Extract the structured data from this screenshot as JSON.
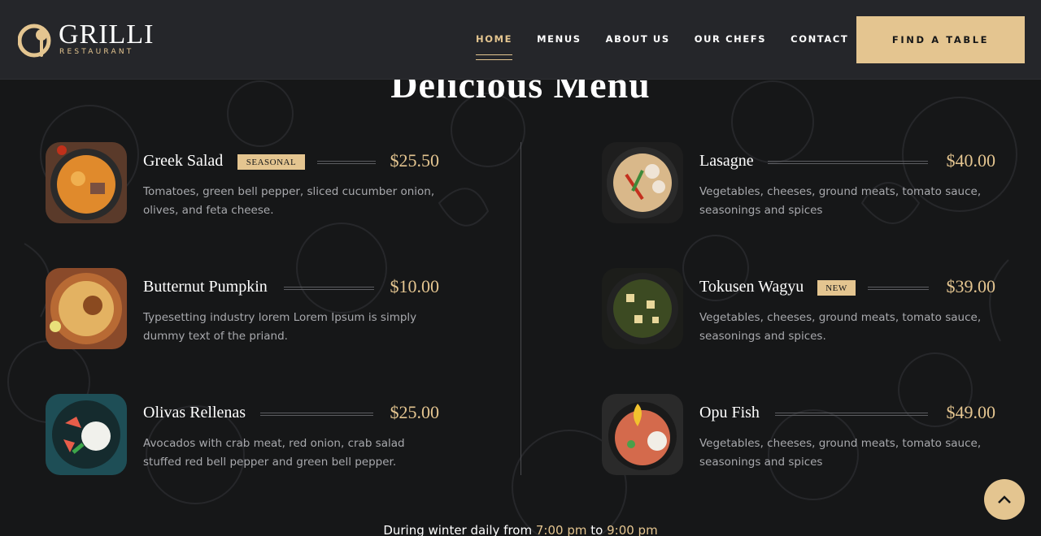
{
  "brand": {
    "name": "GRILLI",
    "tagline": "RESTAURANT"
  },
  "nav": {
    "items": [
      {
        "label": "HOME",
        "active": true
      },
      {
        "label": "MENUS",
        "active": false
      },
      {
        "label": "ABOUT US",
        "active": false
      },
      {
        "label": "OUR CHEFS",
        "active": false
      },
      {
        "label": "CONTACT",
        "active": false
      }
    ],
    "cta": "FIND A TABLE"
  },
  "section": {
    "title": "Delicious Menu"
  },
  "menu": {
    "items": [
      {
        "name": "Greek Salad",
        "badge": "SEASONAL",
        "price": "$25.50",
        "description": "Tomatoes, green bell pepper, sliced cucumber onion, olives, and feta cheese."
      },
      {
        "name": "Lasagne",
        "badge": "",
        "price": "$40.00",
        "description": "Vegetables, cheeses, ground meats, tomato sauce, seasonings and spices"
      },
      {
        "name": "Butternut Pumpkin",
        "badge": "",
        "price": "$10.00",
        "description": "Typesetting industry lorem Lorem Ipsum is simply dummy text of the priand."
      },
      {
        "name": "Tokusen Wagyu",
        "badge": "NEW",
        "price": "$39.00",
        "description": "Vegetables, cheeses, ground meats, tomato sauce, seasonings and spices."
      },
      {
        "name": "Olivas Rellenas",
        "badge": "",
        "price": "$25.00",
        "description": "Avocados with crab meat, red onion, crab salad stuffed red bell pepper and green bell pepper."
      },
      {
        "name": "Opu Fish",
        "badge": "",
        "price": "$49.00",
        "description": "Vegetables, cheeses, ground meats, tomato sauce, seasonings and spices"
      }
    ]
  },
  "hours": {
    "prefix": "During winter daily from",
    "start": "7:00 pm",
    "joiner": "to",
    "end": "9:00 pm"
  },
  "colors": {
    "accent": "#e4c590",
    "background": "#161718",
    "header": "#25262a"
  },
  "icons": {
    "back_to_top": "chevron-up-icon",
    "logo": "cloche-icon"
  }
}
